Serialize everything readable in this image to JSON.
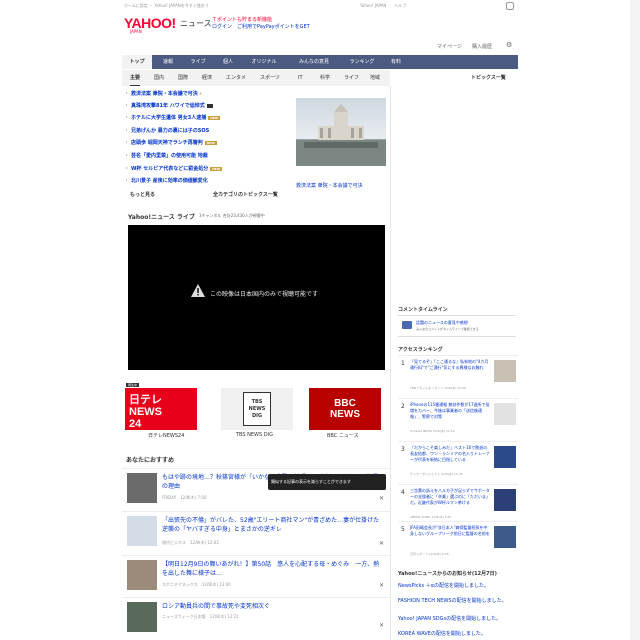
{
  "header": {
    "top_left": "ホームに設定 ・ Yahoo! JAPANを今すぐ使おう",
    "top_right": "Yahoo! JAPAN　　ヘルプ",
    "logo": "YAHOO!",
    "logo_sub": "JAPAN",
    "logo_news": "ニュース",
    "promo_line1": "Ｔポイントも貯まる新機能",
    "promo_line2": "ログイン　ご利用でPayPayポイントをGET",
    "link_mypage": "マイページ",
    "link_buy": "購入履歴",
    "gear_icon": "gear-icon"
  },
  "nav": {
    "tabs": [
      "トップ",
      "速報",
      "ライブ",
      "個人",
      "オリジナル",
      "みんなの意見",
      "ランキング",
      "有料"
    ]
  },
  "subnav": {
    "tabs": [
      "主要",
      "国内",
      "国際",
      "経済",
      "エンタメ",
      "スポーツ",
      "IT",
      "科学",
      "ライフ",
      "地域"
    ],
    "topic_list": "トピックス一覧"
  },
  "topics": [
    {
      "text": "救済法案 衆院・本会議で可決",
      "badge": ""
    },
    {
      "text": "真珠湾攻撃81年 ハワイで追悼式",
      "badge": "video"
    },
    {
      "text": "ホテルに大学生遺体 男女3人逮捕",
      "badge": "NEW"
    },
    {
      "text": "兄弟げんか 暴力の裏には子のSOS",
      "badge": ""
    },
    {
      "text": "店頭歩 堀岡天神でランチ再審判",
      "badge": "NEW"
    },
    {
      "text": "京都・長野でランチ の新書発見",
      "badge": "NEW"
    },
    {
      "text": "芸名「愛内里菜」の使用可能 地裁",
      "badge": ""
    },
    {
      "text": "W杯 セルビア代表などに罰金処分",
      "badge": "NEW"
    },
    {
      "text": "北川景子 産後に効率の価値観変化",
      "badge": ""
    }
  ],
  "topics_more": "もっと見る",
  "topics_all": "全カテゴリのトピックス一覧",
  "feature_caption": "救済法案 衆院・本会議で可決",
  "live": {
    "title": "Yahoo!ニュース ライブ",
    "subtitle": "3チャンネル 合計23,430人が視聴中",
    "video_message": "この映像は日本国内のみで視聴可能です"
  },
  "channels": [
    {
      "label": "日テレNEWS24",
      "brand": "日テレ NEWS 24",
      "live": "再生中"
    },
    {
      "label": "TBS NEWS DIG",
      "brand": "TBS NEWS DIG"
    },
    {
      "label": "BBC ニュース",
      "brand": "BBC NEWS"
    }
  ],
  "recommend": {
    "title": "あなたにおすすめ",
    "tooltip": "類似する記事の表示を減らすことができます",
    "items": [
      {
        "text": "もはや跡の境地…？秋篠宮様が「いかなる非難も甘受」と発言した　かつて独得の理由",
        "meta": "FRIDAY　12/8(木) 7:00"
      },
      {
        "text": "「出張先の不倫」がバレた、52歳\"エリート商社マン\"が青ざめた…妻が仕掛けた逆襲の「ヤバすぎる中身」とまさかの逆ギレ",
        "meta": "現代ビジネス　12/8(木) 12:02"
      },
      {
        "text": "【明日12月9日の舞いあがれ！】第50話　悠人を心配する母・めぐみ　一方、熱を出した舞に様子は…",
        "meta": "スポニチアネックス　12/8(木) 13:00"
      },
      {
        "text": "ロシア動員兵の間で事故死や変死相次ぐ",
        "meta": "ニューズウィーク日本版　12/8(木) 12:21"
      }
    ]
  },
  "sidebar": {
    "comment_title": "コメントタイムライン",
    "comment_link": "話題のニュースの意見や感想",
    "comment_sub": "みんなのコメントがタイムラインで確認できる",
    "ranking_title": "アクセスランキング",
    "ranking": [
      {
        "num": "1",
        "text": "「見てるぞ」「ここ通るな」私有地の\"4カ月通行料\"で\"ご通行\"気にする異様なお触れ",
        "meta": "FNNプライムオンライン 12/8(木) 10:06"
      },
      {
        "text": "iPhoneの115番通報 無効件数が17週所で倍増をカバー、今後は事業者の「送信後通報」、警察で対策",
        "num": "2",
        "meta": "ITmedia NEWS 12/8(木) 12:14"
      },
      {
        "num": "3",
        "text": "「だからこそ楽しみだ」ベスト16で敗退の長友佑都、ワン・ランミアの名入りトレーナーが代表を新結に目指している",
        "meta": "サッカーダイジェスト 12/8(木) 11:25"
      },
      {
        "num": "4",
        "text": "三笘薫の訴えを八ル方子が足らずでサポーターの支援者に「卒業」選ぶのに「ただいま」だ。近畿代表がW杯ルマン挙げる",
        "meta": "ABEMA TIMES 12/8(木) 9:55"
      },
      {
        "num": "5",
        "text": "JFA田嶋会長が\"非日本人\"森保監督続投を中身しないグループリーグ前日に監督の名前を",
        "meta": "日刊スポーツ 12/8(木) 8:45"
      }
    ],
    "notice_title": "Yahoo!ニュースからのお知らせ(12月7日)",
    "notices": [
      "NewsPicks ＋αの配信を開始しました。",
      "FASHION TECH NEWSの配信を開始しました。",
      "Yahoo! JAPAN SDGsの配信を開始しました。",
      "KOREA WAVEの配信を開始しました。"
    ]
  },
  "colors": {
    "brand": "#ff0033",
    "nav": "#4a5a80",
    "link": "#0033cc"
  }
}
